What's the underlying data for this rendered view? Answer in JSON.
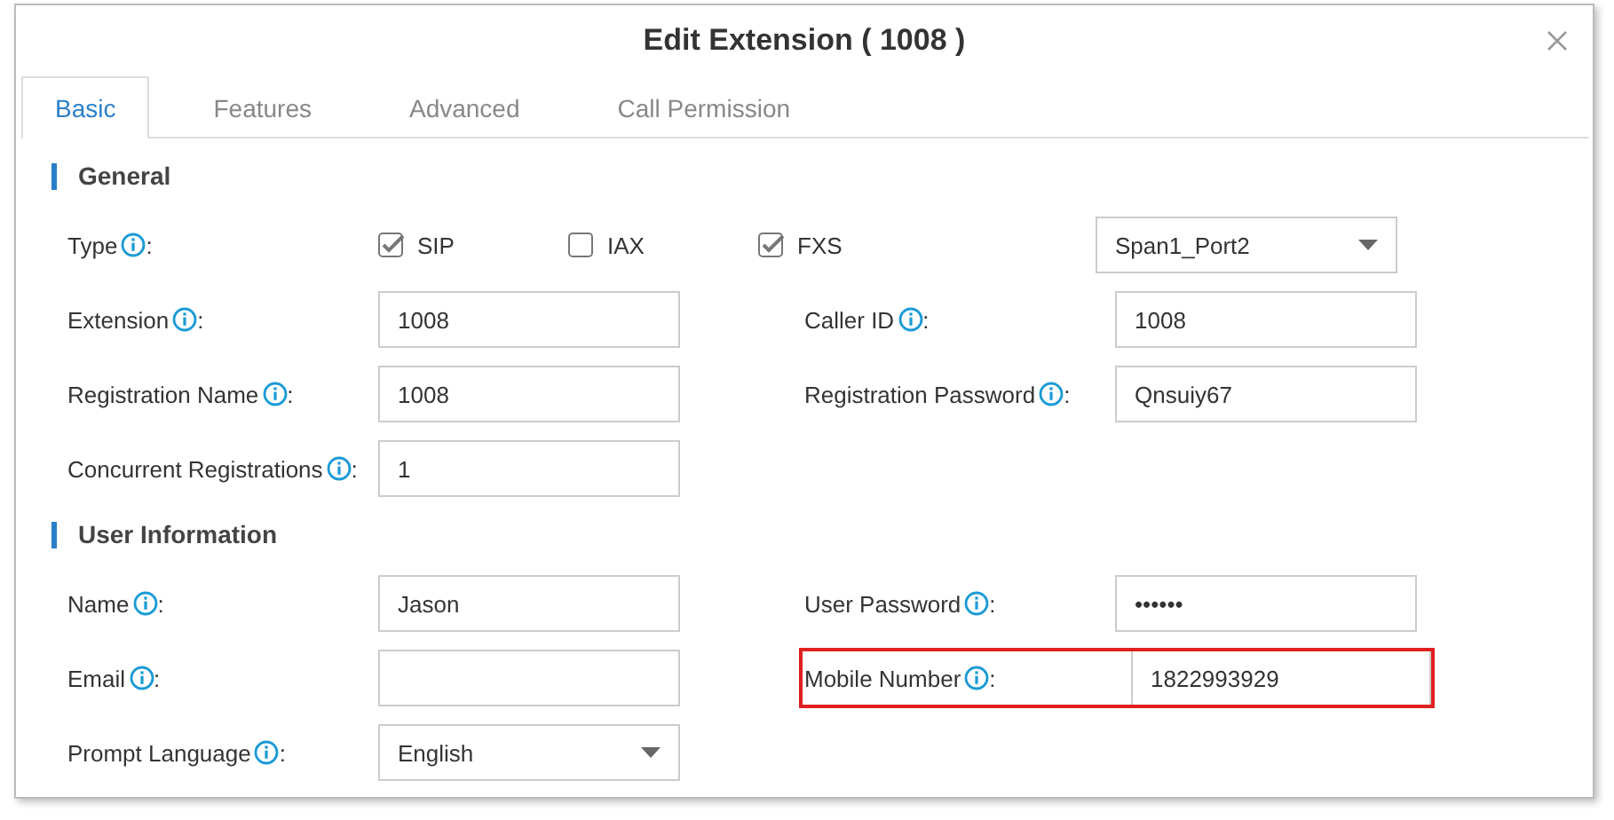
{
  "window": {
    "title": "Edit Extension ( 1008 )"
  },
  "tabs": [
    {
      "label": "Basic",
      "selected": true
    },
    {
      "label": "Features",
      "selected": false
    },
    {
      "label": "Advanced",
      "selected": false
    },
    {
      "label": "Call Permission",
      "selected": false
    }
  ],
  "sections": [
    {
      "title": "General",
      "rows": [
        {
          "cells": [
            {
              "kind": "checks",
              "label": "Type",
              "suffix": ":",
              "options": [
                {
                  "label": "SIP",
                  "checked": true
                },
                {
                  "label": "IAX",
                  "checked": false
                },
                {
                  "label": "FXS",
                  "checked": true
                }
              ]
            },
            {
              "kind": "select",
              "value": "Span1_Port2"
            }
          ]
        },
        {
          "cells": [
            {
              "kind": "text",
              "label": "Extension",
              "suffix": ":",
              "value": "1008"
            },
            {
              "kind": "text",
              "label": "Caller ID",
              "suffix": ":",
              "value": "1008"
            }
          ]
        },
        {
          "cells": [
            {
              "kind": "text",
              "label": "Registration Name",
              "suffix": ":",
              "value": "1008"
            },
            {
              "kind": "text",
              "label": "Registration Password",
              "suffix": ":",
              "value": "Qnsuiy67"
            }
          ]
        },
        {
          "cells": [
            {
              "kind": "text",
              "label": "Concurrent Registrations",
              "suffix": ":",
              "value": "1"
            }
          ]
        }
      ]
    },
    {
      "title": "User Information",
      "rows": [
        {
          "cells": [
            {
              "kind": "text",
              "label": "Name",
              "suffix": ":",
              "value": "Jason"
            },
            {
              "kind": "text",
              "label": "User Password",
              "suffix": ":",
              "value": "••••••"
            }
          ]
        },
        {
          "cells": [
            {
              "kind": "text",
              "label": "Email",
              "suffix": ":"
            },
            {
              "kind": "text",
              "label": "Mobile Number",
              "suffix": ":",
              "value": "1822993929",
              "highlighted": true
            }
          ]
        },
        {
          "cells": [
            {
              "kind": "select",
              "label": "Prompt Language",
              "suffix": ":",
              "value": "English"
            }
          ]
        }
      ]
    }
  ]
}
